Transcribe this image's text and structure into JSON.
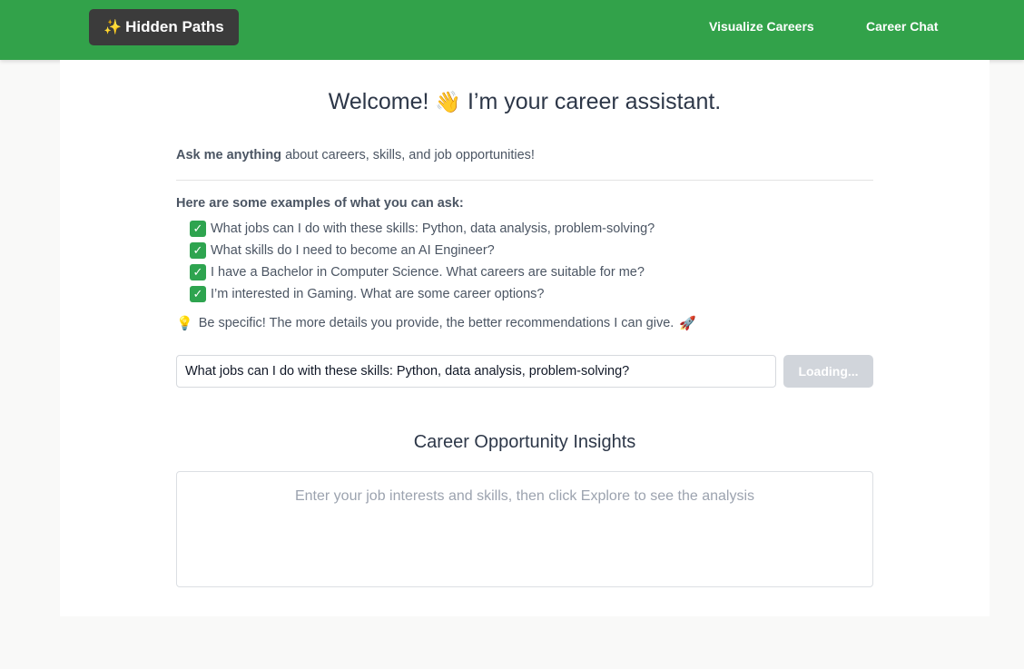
{
  "header": {
    "brand_icon": "✨",
    "brand_label": "Hidden Paths",
    "nav": {
      "visualize": "Visualize Careers",
      "chat": "Career Chat"
    }
  },
  "welcome": {
    "title_before": "Welcome!",
    "wave_emoji": "👋",
    "title_after": "I’m your career assistant."
  },
  "intro": {
    "bold": "Ask me anything",
    "rest": "about careers, skills, and job opportunities!"
  },
  "examples": {
    "title": "Here are some examples of what you can ask:",
    "items": [
      "What jobs can I do with these skills: Python, data analysis, problem-solving?",
      "What skills do I need to become an AI Engineer?",
      "I have a Bachelor in Computer Science. What careers are suitable for me?",
      "I’m interested in Gaming. What are some career options?"
    ]
  },
  "tip": {
    "text": "Be specific! The more details you provide, the better recommendations I can give."
  },
  "query": {
    "value": "What jobs can I do with these skills: Python, data analysis, problem-solving?",
    "button_label": "Loading..."
  },
  "insights": {
    "title": "Career Opportunity Insights",
    "placeholder": "Enter your job interests and skills, then click Explore to see the analysis"
  },
  "icons": {
    "brand": "sparkles-icon",
    "wave": "waving-hand-icon",
    "check": "check-mark-button-icon",
    "tip": "light-bulb-icon",
    "rocket": "rocket-icon"
  },
  "colors": {
    "header_bg": "#32a24a",
    "brand_bg": "#3b3b3b",
    "check_green": "#2ea44f",
    "button_disabled": "#d1d5db"
  }
}
